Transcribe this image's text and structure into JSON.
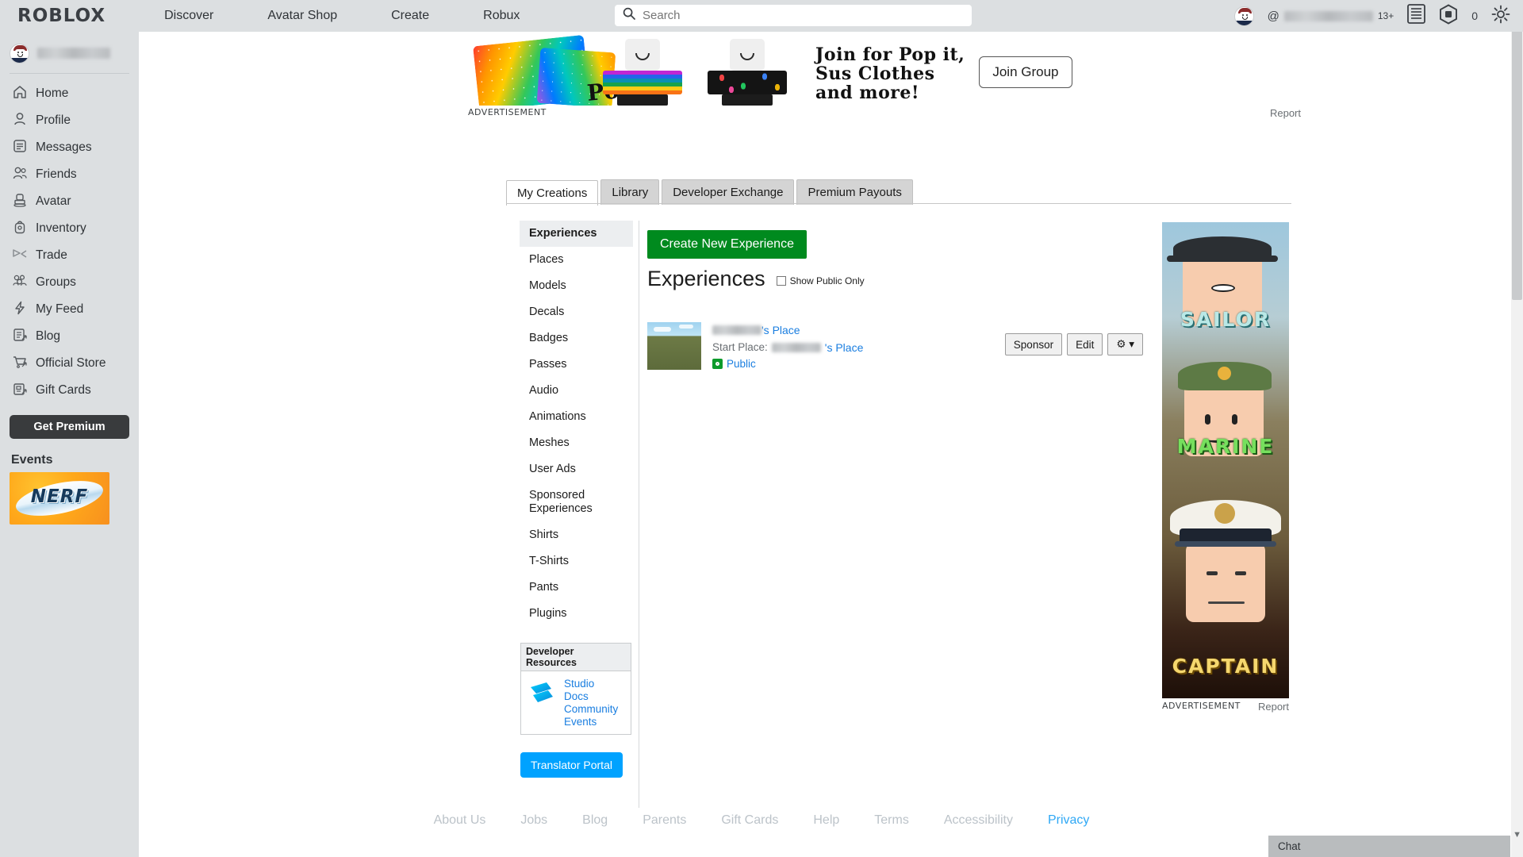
{
  "topnav": {
    "logo": "ROBLOX",
    "links": [
      {
        "label": "Discover",
        "name": "nav-discover"
      },
      {
        "label": "Avatar Shop",
        "name": "nav-avatar-shop"
      },
      {
        "label": "Create",
        "name": "nav-create"
      },
      {
        "label": "Robux",
        "name": "nav-robux"
      }
    ],
    "search_placeholder": "Search",
    "search_value": "",
    "age_tag": "13+",
    "at_sign": "@",
    "username_blurred": "",
    "robux_count": "0"
  },
  "sidebar": {
    "username_blurred": "",
    "items": [
      {
        "label": "Home",
        "icon": "home-icon"
      },
      {
        "label": "Profile",
        "icon": "person-icon"
      },
      {
        "label": "Messages",
        "icon": "message-icon"
      },
      {
        "label": "Friends",
        "icon": "friends-icon"
      },
      {
        "label": "Avatar",
        "icon": "avatar-icon"
      },
      {
        "label": "Inventory",
        "icon": "inventory-icon"
      },
      {
        "label": "Trade",
        "icon": "trade-icon"
      },
      {
        "label": "Groups",
        "icon": "groups-icon"
      },
      {
        "label": "My Feed",
        "icon": "feed-icon"
      },
      {
        "label": "Blog",
        "icon": "blog-icon"
      },
      {
        "label": "Official Store",
        "icon": "store-icon"
      },
      {
        "label": "Gift Cards",
        "icon": "giftcard-icon"
      }
    ],
    "get_premium": "Get Premium",
    "events_title": "Events",
    "events_ad_text": "NERF"
  },
  "banner_ad": {
    "headline_line1": "Join for Pop it,",
    "headline_line2": "Sus Clothes",
    "headline_line3": "and more!",
    "popit_word": "Pop It!",
    "join_button": "Join Group",
    "ad_label": "ADVERTISEMENT",
    "report": "Report"
  },
  "tabs": [
    {
      "label": "My Creations",
      "active": true
    },
    {
      "label": "Library",
      "active": false
    },
    {
      "label": "Developer Exchange",
      "active": false
    },
    {
      "label": "Premium Payouts",
      "active": false
    }
  ],
  "subnav": [
    {
      "label": "Experiences",
      "active": true
    },
    {
      "label": "Places",
      "active": false
    },
    {
      "label": "Models",
      "active": false
    },
    {
      "label": "Decals",
      "active": false
    },
    {
      "label": "Badges",
      "active": false
    },
    {
      "label": "Passes",
      "active": false
    },
    {
      "label": "Audio",
      "active": false
    },
    {
      "label": "Animations",
      "active": false
    },
    {
      "label": "Meshes",
      "active": false
    },
    {
      "label": "User Ads",
      "active": false
    },
    {
      "label": "Sponsored Experiences",
      "active": false
    },
    {
      "label": "Shirts",
      "active": false
    },
    {
      "label": "T-Shirts",
      "active": false
    },
    {
      "label": "Pants",
      "active": false
    },
    {
      "label": "Plugins",
      "active": false
    }
  ],
  "dev_resources": {
    "title": "Developer Resources",
    "links": [
      "Studio",
      "Docs",
      "Community",
      "Events"
    ]
  },
  "translator_button": "Translator Portal",
  "main": {
    "create_button": "Create New Experience",
    "section_title": "Experiences",
    "show_public_only": "Show Public Only",
    "show_public_only_checked": false,
    "experiences": [
      {
        "name_suffix": "'s Place",
        "name_blurred": "",
        "start_place_label": "Start Place:",
        "start_place_suffix": "'s Place",
        "start_place_blurred": "",
        "status": "Public",
        "buttons": [
          "Sponsor",
          "Edit"
        ],
        "gear_button": "⚙ ▾"
      }
    ]
  },
  "right_ad": {
    "word1": "SAILOR",
    "word2": "MARINE",
    "word3": "CAPTAIN",
    "ad_label": "ADVERTISEMENT",
    "report": "Report"
  },
  "footer": {
    "links": [
      {
        "label": "About Us",
        "accent": false
      },
      {
        "label": "Jobs",
        "accent": false
      },
      {
        "label": "Blog",
        "accent": false
      },
      {
        "label": "Parents",
        "accent": false
      },
      {
        "label": "Gift Cards",
        "accent": false
      },
      {
        "label": "Help",
        "accent": false
      },
      {
        "label": "Terms",
        "accent": false
      },
      {
        "label": "Accessibility",
        "accent": false
      },
      {
        "label": "Privacy",
        "accent": true
      }
    ]
  },
  "chat": {
    "label": "Chat"
  },
  "colors": {
    "header_bg": "#dcdfe1",
    "accent_blue": "#1a7ee0",
    "green_button": "#008a1e",
    "translator_blue": "#00a2ff",
    "premium_dark": "#393b3d",
    "public_green": "#0d9b2c"
  }
}
